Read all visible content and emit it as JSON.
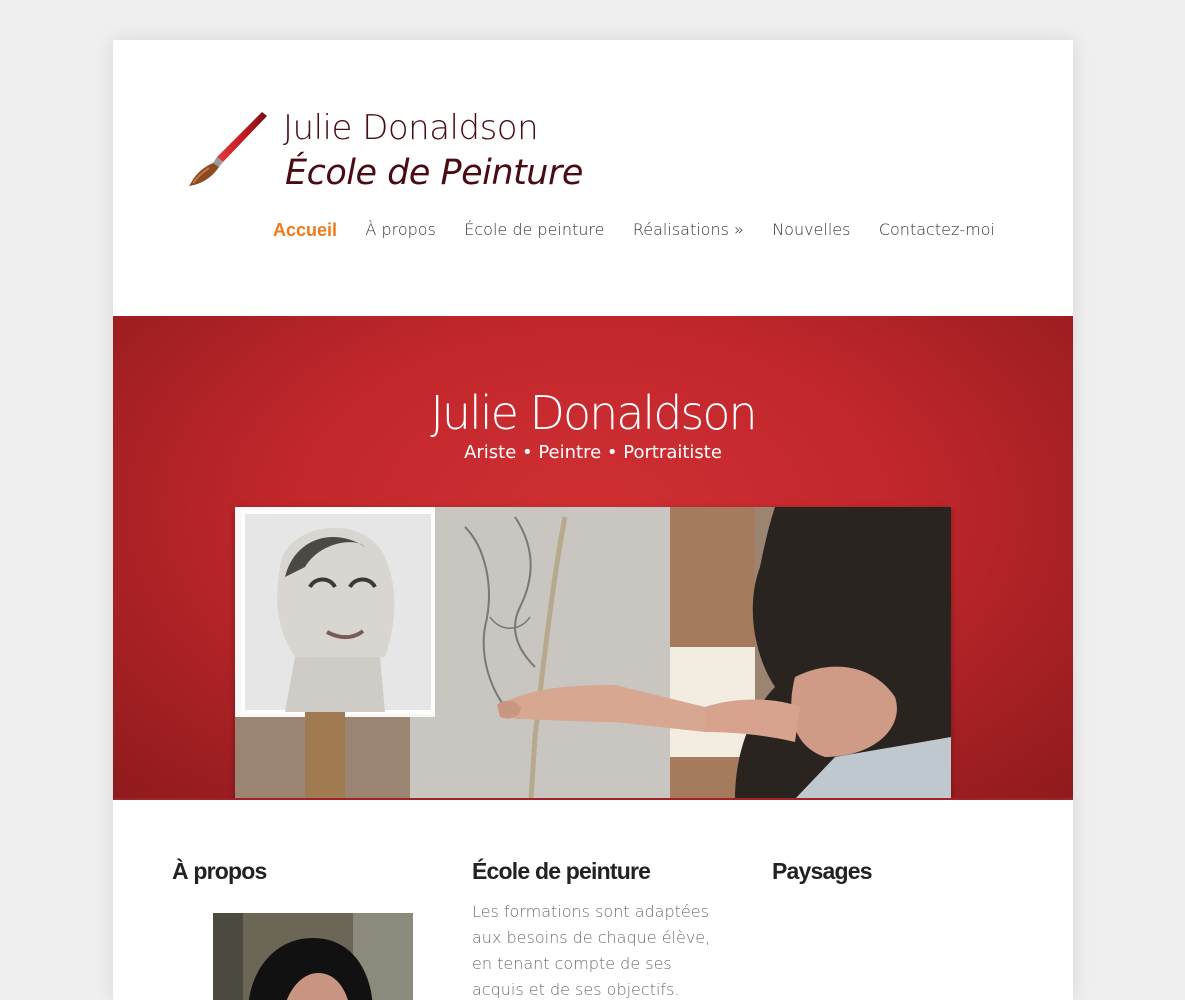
{
  "header": {
    "title_line1": "Julie Donaldson",
    "title_line2": "École de Peinture",
    "logo_icon": "paintbrush-icon"
  },
  "nav": {
    "items": [
      {
        "label": "Accueil",
        "active": true
      },
      {
        "label": "À propos"
      },
      {
        "label": "École de peinture"
      },
      {
        "label": "Réalisations »"
      },
      {
        "label": "Nouvelles"
      },
      {
        "label": "Contactez-moi"
      }
    ]
  },
  "hero": {
    "title": "Julie Donaldson",
    "subtitle": "Ariste • Peintre • Portraitiste"
  },
  "columns": [
    {
      "heading": "À propos"
    },
    {
      "heading": "École de peinture",
      "text": "Les formations sont adaptées aux besoins de chaque élève, en tenant compte de ses acquis et de ses objectifs."
    },
    {
      "heading": "Paysages"
    }
  ],
  "colors": {
    "accent": "#f07a1a",
    "title": "#4a0c14",
    "hero_red": "#c1272c"
  }
}
